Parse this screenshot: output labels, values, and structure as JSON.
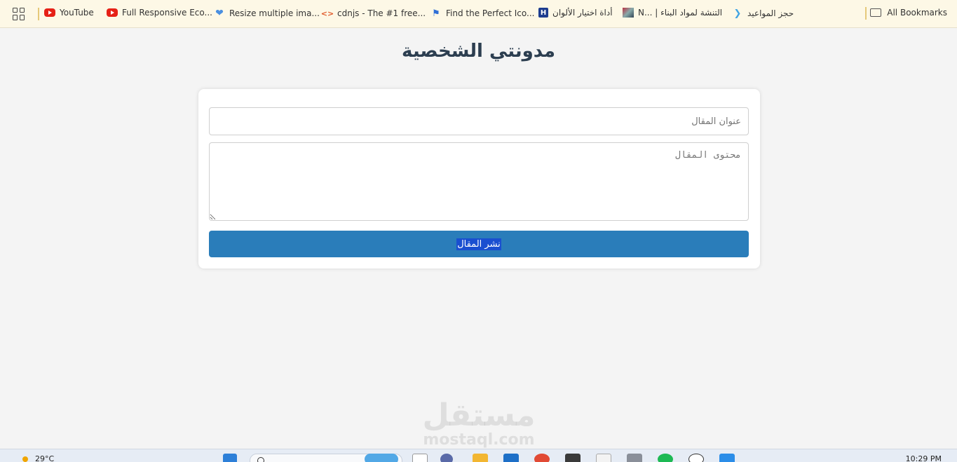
{
  "bookmarks": {
    "items": [
      {
        "label": "YouTube",
        "icon": "youtube-icon"
      },
      {
        "label": "Full Responsive Eco...",
        "icon": "youtube-icon"
      },
      {
        "label": "Resize multiple ima...",
        "icon": "heart-icon"
      },
      {
        "label": "cdnjs - The #1 free...",
        "icon": "code-icon"
      },
      {
        "label": "Find the Perfect Ico...",
        "icon": "flag-icon"
      },
      {
        "label": "أداة اختيار الألوان",
        "icon": "h-icon"
      },
      {
        "label": "N... | التنشة لمواد البناء",
        "icon": "image-icon"
      },
      {
        "label": "حجز المواعيد",
        "icon": "flutter-icon"
      }
    ],
    "all_label": "All Bookmarks"
  },
  "page": {
    "title": "مدونتي الشخصية"
  },
  "form": {
    "title_placeholder": "عنوان المقال",
    "content_placeholder": "محتوى المقال",
    "publish_label": "نشر المقال"
  },
  "watermark": {
    "arabic": "مستقل",
    "latin": "mostaql.com"
  },
  "taskbar": {
    "temperature": "29°C",
    "time": "10:29 PM"
  },
  "colors": {
    "button": "#2a7dba",
    "title": "#2c3e50",
    "background": "#f4f4f4"
  }
}
